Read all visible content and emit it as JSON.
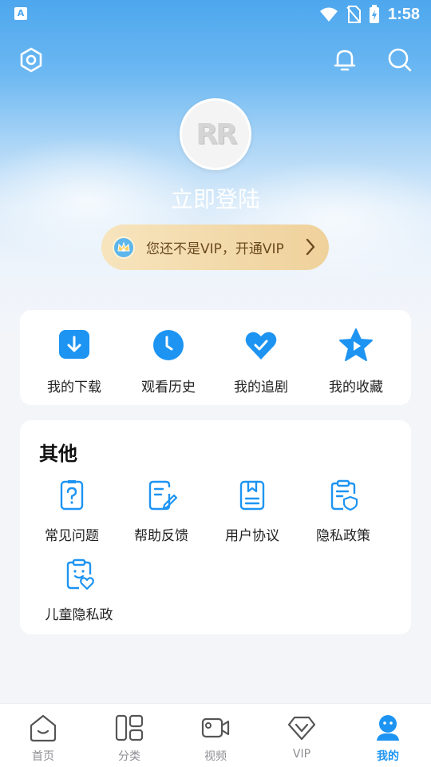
{
  "status_bar": {
    "app_letter": "A",
    "time": "1:58"
  },
  "profile": {
    "login_label": "立即登陆",
    "avatar_logo": "RR"
  },
  "vip": {
    "text": "您还不是VIP，开通VIP"
  },
  "quick_actions": [
    {
      "label": "我的下载",
      "icon": "download-icon"
    },
    {
      "label": "观看历史",
      "icon": "clock-icon"
    },
    {
      "label": "我的追剧",
      "icon": "heart-icon"
    },
    {
      "label": "我的收藏",
      "icon": "star-icon"
    }
  ],
  "other": {
    "title": "其他",
    "items": [
      {
        "label": "常见问题",
        "icon": "faq-icon"
      },
      {
        "label": "帮助反馈",
        "icon": "feedback-icon"
      },
      {
        "label": "用户协议",
        "icon": "agreement-icon"
      },
      {
        "label": "隐私政策",
        "icon": "privacy-icon"
      },
      {
        "label": "儿童隐私政",
        "icon": "child-privacy-icon"
      }
    ]
  },
  "tabs": [
    {
      "label": "首页",
      "icon": "home-icon"
    },
    {
      "label": "分类",
      "icon": "category-icon"
    },
    {
      "label": "视频",
      "icon": "video-icon"
    },
    {
      "label": "VIP",
      "icon": "vip-diamond-icon"
    },
    {
      "label": "我的",
      "icon": "profile-icon",
      "active": true
    }
  ],
  "colors": {
    "accent": "#1d94f2",
    "vip_text": "#6b4a1f"
  }
}
